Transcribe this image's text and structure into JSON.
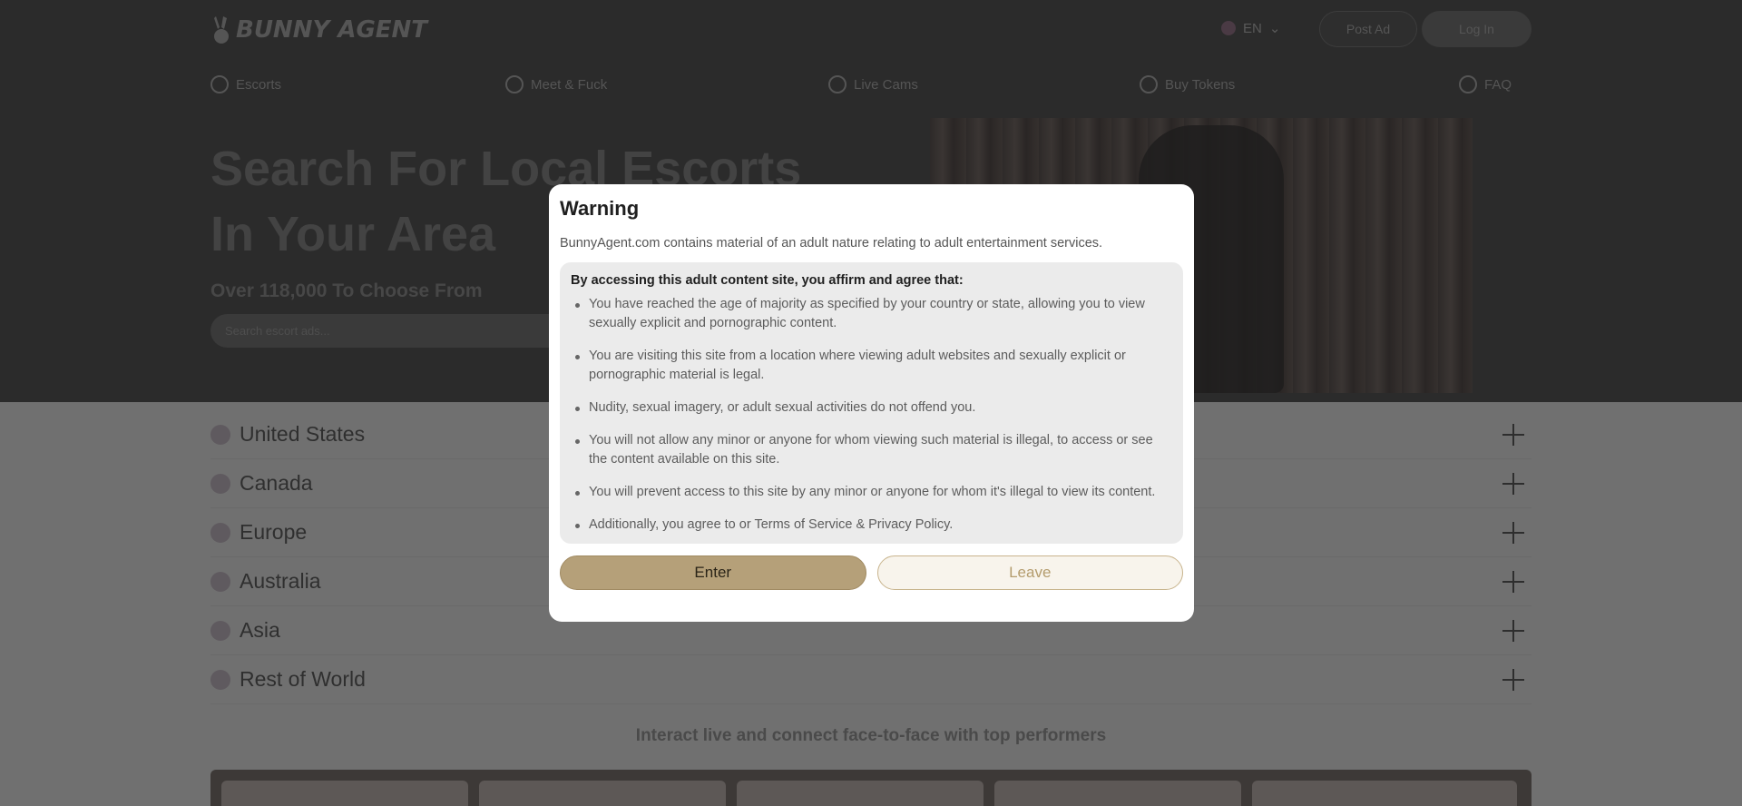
{
  "header": {
    "logo_text": "BUNNY AGENT",
    "language": "EN",
    "post_ad_label": "Post Ad",
    "login_label": "Log In"
  },
  "nav": [
    {
      "label": "Escorts",
      "icon": "map-pin-icon"
    },
    {
      "label": "Meet & Fuck",
      "icon": "chat-hearts-icon"
    },
    {
      "label": "Live Cams",
      "icon": "webcam-icon"
    },
    {
      "label": "Buy Tokens",
      "icon": "token-icon"
    },
    {
      "label": "FAQ",
      "icon": "question-bubble-icon"
    }
  ],
  "hero": {
    "title": "Search For Local Escorts In Your Area",
    "subtitle": "Over 118,000 To Choose From",
    "search_placeholder": "Search escort ads..."
  },
  "regions": [
    {
      "name": "United States",
      "flag": "us-flag-icon"
    },
    {
      "name": "Canada",
      "flag": "canada-flag-icon"
    },
    {
      "name": "Europe",
      "flag": "eu-flag-icon"
    },
    {
      "name": "Australia",
      "flag": "australia-flag-icon"
    },
    {
      "name": "Asia",
      "flag": "asia-flag-icon"
    },
    {
      "name": "Rest of World",
      "flag": "globe-icon"
    }
  ],
  "live_section": {
    "title": "Interact live and connect face-to-face with top performers"
  },
  "modal": {
    "title": "Warning",
    "intro": "BunnyAgent.com contains material of an adult nature relating to adult entertainment services.",
    "lead": "By accessing this adult content site, you affirm and agree that:",
    "items": [
      "You have reached the age of majority as specified by your country or state, allowing you to view sexually explicit and pornographic content.",
      "You are visiting this site from a location where viewing adult websites and sexually explicit or pornographic material is legal.",
      "Nudity, sexual imagery, or adult sexual activities do not offend you.",
      "You will not allow any minor or anyone for whom viewing such material is illegal, to access or see the content available on this site.",
      "You will prevent access to this site by any minor or anyone for whom it's illegal to view its content.",
      "Additionally, you agree to or Terms of Service & Privacy Policy."
    ],
    "enter_label": "Enter",
    "leave_label": "Leave"
  },
  "colors": {
    "overlay_dark": "#2b2b2b",
    "overlay_light": "#707070",
    "accent_gold": "#b5a079",
    "leave_bg": "#f8f4ec"
  }
}
